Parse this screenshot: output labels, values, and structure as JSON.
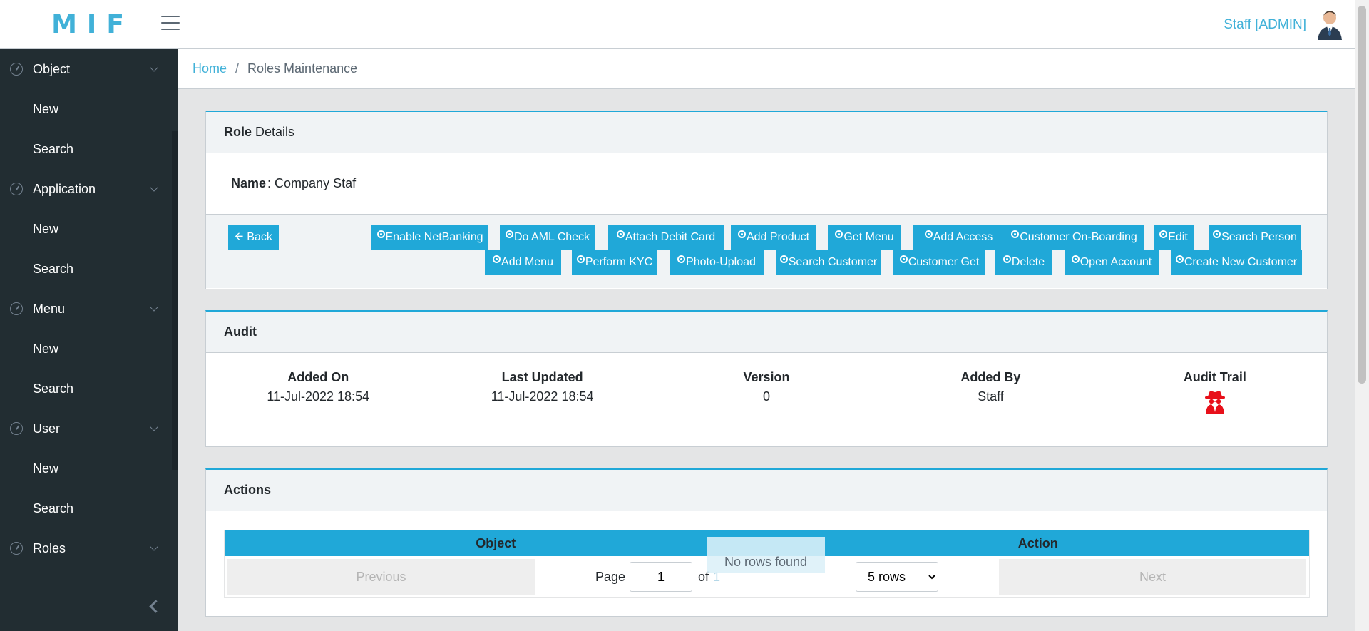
{
  "brand": "MIF",
  "user": {
    "label": "Staff [ADMIN]"
  },
  "sidebar": {
    "groups": [
      {
        "label": "Object",
        "new": "New",
        "search": "Search"
      },
      {
        "label": "Application",
        "new": "New",
        "search": "Search"
      },
      {
        "label": "Menu",
        "new": "New",
        "search": "Search"
      },
      {
        "label": "User",
        "new": "New",
        "search": "Search"
      },
      {
        "label": "Roles"
      }
    ]
  },
  "breadcrumb": {
    "home": "Home",
    "separator": "/",
    "current": "Roles Maintenance"
  },
  "role_card": {
    "title_bold": "Role",
    "title_rest": "Details",
    "name_label": "Name",
    "name_value": ": Company Staf",
    "back_label": "Back",
    "actions_row1": [
      "Enable NetBanking",
      "Do AML Check",
      "Attach Debit Card",
      "Add Product",
      "Get Menu",
      "Add Access",
      "Customer On-Boarding",
      "Edit",
      "Search Person"
    ],
    "actions_row2": [
      "Add Menu",
      "Perform KYC",
      "Photo-Upload",
      "Search Customer",
      "Customer Get",
      "Delete",
      "Open Account",
      "Create New Customer"
    ]
  },
  "audit": {
    "title": "Audit",
    "added_on_label": "Added On",
    "added_on": "11-Jul-2022 18:54",
    "last_updated_label": "Last Updated",
    "last_updated": "11-Jul-2022 18:54",
    "version_label": "Version",
    "version": "0",
    "added_by_label": "Added By",
    "added_by": "Staff",
    "audit_trail_label": "Audit Trail",
    "audit_trail_icon": "spy-icon"
  },
  "actions": {
    "title": "Actions",
    "columns": [
      "Object",
      "Action"
    ],
    "empty_text": "No rows found",
    "previous": "Previous",
    "next": "Next",
    "page_label": "Page",
    "page_value": "1",
    "of_label": "of",
    "total_pages": "1",
    "rows_option": "5 rows"
  },
  "colors": {
    "accent": "#20a8d8",
    "brand": "#41b1d8",
    "sidebar": "#222d32"
  }
}
